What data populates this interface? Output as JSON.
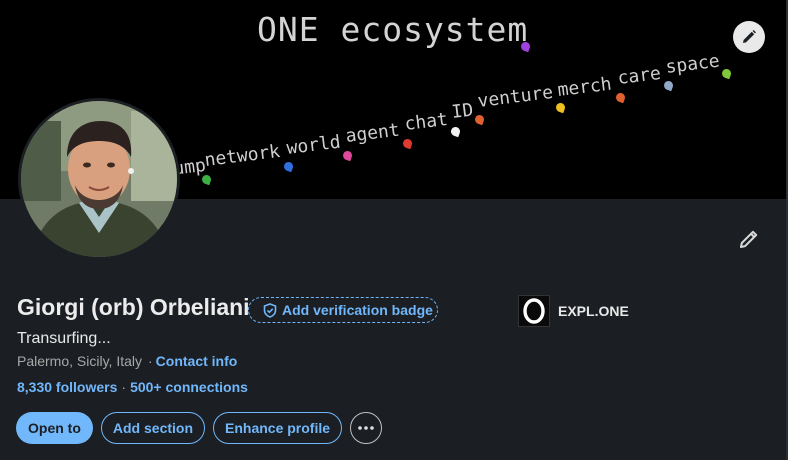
{
  "banner": {
    "title": "ONE ecosystem",
    "words": [
      {
        "text": "jump",
        "dot_color": "#3cb043"
      },
      {
        "text": "network",
        "dot_color": "#2f6fe0"
      },
      {
        "text": "world",
        "dot_color": "#e0489b"
      },
      {
        "text": "agent",
        "dot_color": "#e03a2f"
      },
      {
        "text": "chat",
        "dot_color": "#f2f2f2"
      },
      {
        "text": "ID",
        "dot_color": "#e0602f"
      },
      {
        "text": "venture",
        "dot_color": "#f0c020"
      },
      {
        "text": "merch",
        "dot_color": "#e0602f"
      },
      {
        "text": "care",
        "dot_color": "#8fa8c8"
      },
      {
        "text": "space",
        "dot_color": "#7ec83a"
      }
    ],
    "title_dot_color": "#a142e0",
    "edit_icon": "pencil-icon"
  },
  "profile": {
    "name": "Giorgi (orb) Orbeliani",
    "verify_badge_label": "Add verification badge",
    "headline": "Transurfing...",
    "location": "Palermo, Sicily, Italy",
    "location_separator": "·",
    "contact_info_label": "Contact info",
    "followers_label": "8,330 followers",
    "stats_separator": "·",
    "connections_label": "500+ connections",
    "edit_icon": "pencil-icon"
  },
  "company": {
    "logo_letter": "O",
    "name": "EXPL.ONE"
  },
  "actions": {
    "open_to_label": "Open to",
    "add_section_label": "Add section",
    "enhance_profile_label": "Enhance profile",
    "more_icon": "ellipsis-icon"
  },
  "colors": {
    "accent": "#71b7fb",
    "background": "#1b1f23",
    "banner_background": "#000000"
  }
}
